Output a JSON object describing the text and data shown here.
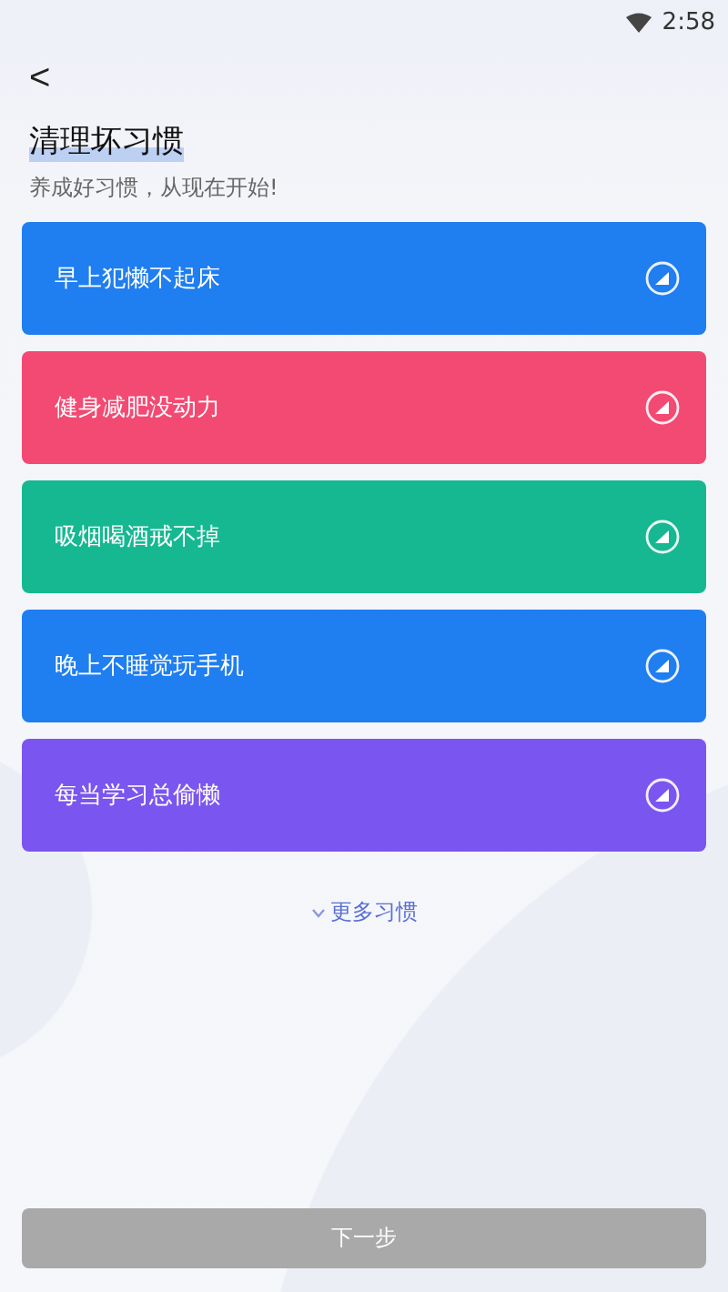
{
  "status_bar": {
    "time": "2:58"
  },
  "header": {
    "back": "<",
    "title": "清理坏习惯",
    "subtitle": "养成好习惯，从现在开始!"
  },
  "habits": [
    {
      "label": "早上犯懒不起床",
      "color": "#1f7ef0",
      "selected": false
    },
    {
      "label": "健身减肥没动力",
      "color": "#f24a73",
      "selected": false
    },
    {
      "label": "吸烟喝酒戒不掉",
      "color": "#16b891",
      "selected": false
    },
    {
      "label": "晚上不睡觉玩手机",
      "color": "#1f7ef0",
      "selected": false
    },
    {
      "label": "每当学习总偷懒",
      "color": "#7b55ef",
      "selected": false
    }
  ],
  "more": {
    "label": "更多习惯"
  },
  "next_button": {
    "label": "下一步",
    "disabled": true
  }
}
